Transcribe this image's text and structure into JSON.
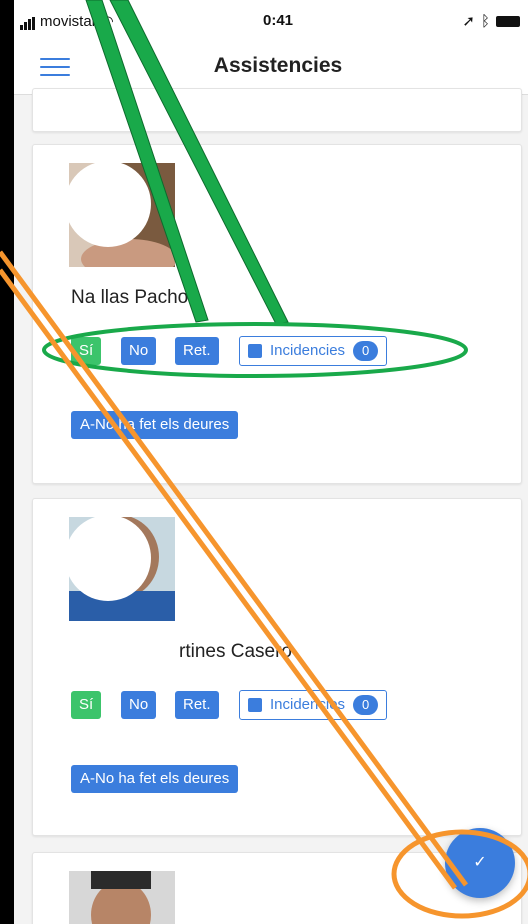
{
  "status_bar": {
    "carrier": "movistar",
    "time": "0:41"
  },
  "header": {
    "title": "Assistencies"
  },
  "cards": [
    {
      "name": "Na           llas Pachon",
      "si": "Sí",
      "no": "No",
      "ret": "Ret.",
      "incidencies": "Incidencies",
      "count": "0",
      "tag": "A-No ha fet els deures"
    },
    {
      "name": "rtines Casero",
      "si": "Sí",
      "no": "No",
      "ret": "Ret.",
      "incidencies": "Incidencies",
      "count": "0",
      "tag": "A-No ha fet els deures"
    }
  ],
  "fab": {
    "icon": "check-icon",
    "glyph": "✓"
  },
  "colors": {
    "primary": "#3b7ddd",
    "success": "#3cc46b",
    "green_annotation": "#19a94a",
    "orange_annotation": "#f6952d"
  }
}
